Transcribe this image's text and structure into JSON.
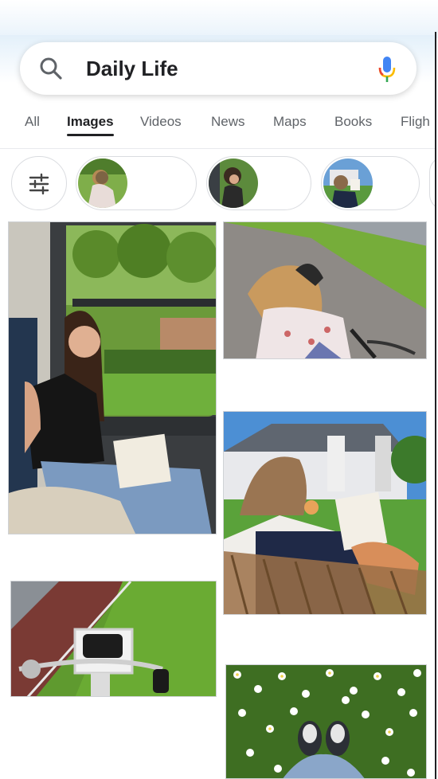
{
  "search": {
    "query": "Daily Life"
  },
  "tabs": [
    {
      "label": "All"
    },
    {
      "label": "Images"
    },
    {
      "label": "Videos"
    },
    {
      "label": "News"
    },
    {
      "label": "Maps"
    },
    {
      "label": "Books"
    },
    {
      "label": "Fligh"
    }
  ],
  "active_tab": "Images",
  "chips": [
    {
      "name": "filter",
      "icon": "tune-icon"
    },
    {
      "name": "girl-bike-chip"
    },
    {
      "name": "train-chip"
    },
    {
      "name": "reading-chip"
    }
  ],
  "results": [
    {
      "name": "girl-on-train"
    },
    {
      "name": "child-on-bike"
    },
    {
      "name": "girl-reading-outdoors"
    },
    {
      "name": "bike-path-basket"
    },
    {
      "name": "flowers-sneakers"
    }
  ],
  "colors": {
    "accent_blue": "#4285f4",
    "mic_red": "#ea4335",
    "mic_yellow": "#fbbc04",
    "mic_green": "#34a853"
  }
}
